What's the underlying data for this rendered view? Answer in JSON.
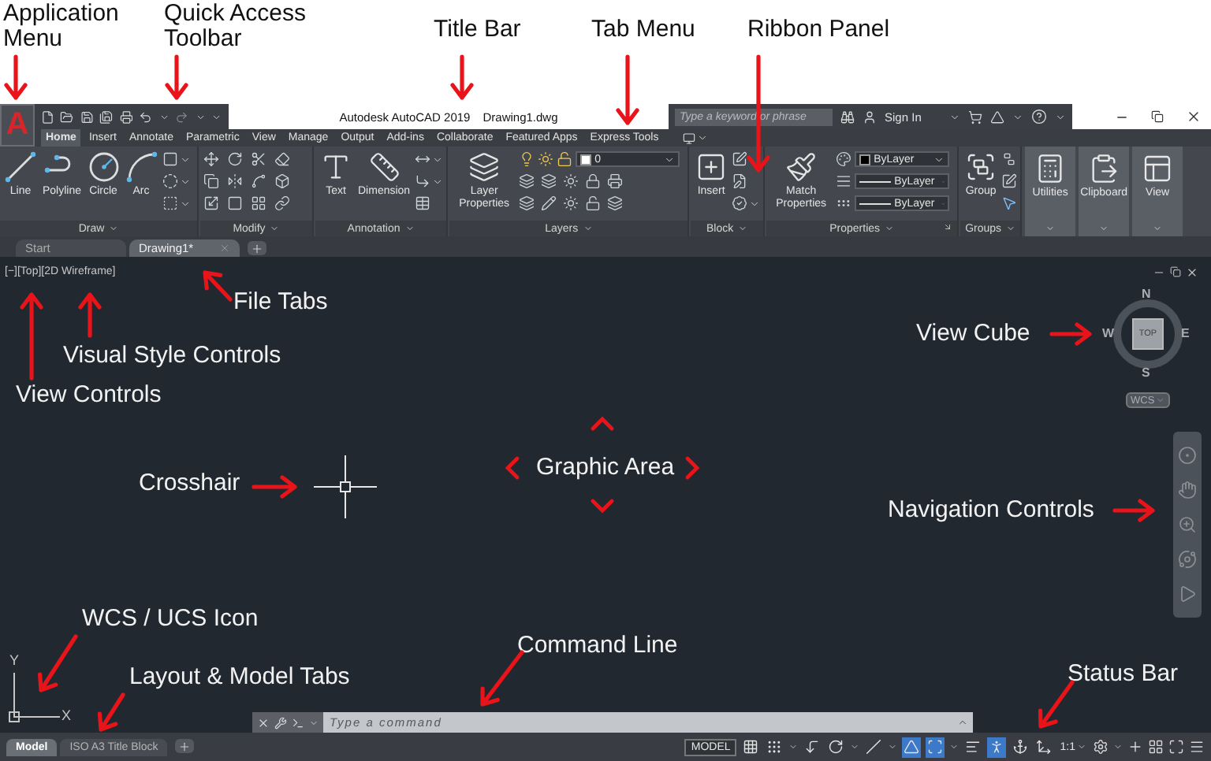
{
  "annotations": [
    "Application Menu",
    "Quick Access Toolbar",
    "Title Bar",
    "Tab Menu",
    "Ribbon Panel",
    "File Tabs",
    "Visual Style Controls",
    "View Controls",
    "View Cube",
    "Crosshair",
    "Graphic Area",
    "Navigation Controls",
    "WCS / UCS Icon",
    "Layout & Model Tabs",
    "Command Line",
    "Status Bar"
  ],
  "app_menu": {
    "logo": "A"
  },
  "title_bar": {
    "app": "Autodesk AutoCAD 2019",
    "file": "Drawing1.dwg",
    "search": {
      "placeholder": "Type a keyword or phrase"
    },
    "sign_in": "Sign In"
  },
  "menu_tabs": [
    {
      "label": "Home",
      "selected": true
    },
    {
      "label": "Insert",
      "selected": false
    },
    {
      "label": "Annotate",
      "selected": false
    },
    {
      "label": "Parametric",
      "selected": false
    },
    {
      "label": "View",
      "selected": false
    },
    {
      "label": "Manage",
      "selected": false
    },
    {
      "label": "Output",
      "selected": false
    },
    {
      "label": "Add-ins",
      "selected": false
    },
    {
      "label": "Collaborate",
      "selected": false
    },
    {
      "label": "Featured Apps",
      "selected": false
    },
    {
      "label": "Express Tools",
      "selected": false
    }
  ],
  "ribbon_panels": [
    {
      "kind": "full",
      "title": "Draw",
      "tools": [
        "Line",
        "Polyline",
        "Circle",
        "Arc"
      ]
    },
    {
      "kind": "full",
      "title": "Modify"
    },
    {
      "kind": "full",
      "title": "Annotation",
      "tools": [
        "Text",
        "Dimension"
      ]
    },
    {
      "kind": "full",
      "title": "Layers",
      "tools": [
        "Layer Properties"
      ],
      "layer": "0"
    },
    {
      "kind": "full",
      "title": "Block",
      "tools": [
        "Insert"
      ]
    },
    {
      "kind": "full",
      "title": "Properties",
      "tools": [
        "Match Properties"
      ],
      "dropdowns": [
        "ByLayer",
        "ByLayer",
        "ByLayer"
      ]
    },
    {
      "kind": "full",
      "title": "Groups",
      "tools": [
        "Group"
      ]
    },
    {
      "kind": "collapsed",
      "label": "Utilities"
    },
    {
      "kind": "collapsed",
      "label": "Clipboard"
    },
    {
      "kind": "collapsed",
      "label": "View"
    }
  ],
  "file_tabs": [
    {
      "label": "Start",
      "selected": false
    },
    {
      "label": "Drawing1*",
      "selected": true
    }
  ],
  "viewport": {
    "controls": [
      "[−]",
      "[Top]",
      "[2D Wireframe]"
    ],
    "view_cube": {
      "face": "TOP",
      "compass": [
        "N",
        "E",
        "S",
        "W"
      ],
      "ucs_menu": "WCS"
    },
    "ucs_axes": [
      "X",
      "Y"
    ]
  },
  "command_line": {
    "placeholder": "Type a command"
  },
  "layout_tabs": [
    {
      "label": "Model",
      "selected": true
    },
    {
      "label": "ISO A3 Title Block",
      "selected": false
    }
  ],
  "status_bar": {
    "mode": "MODEL",
    "scale": "1:1",
    "toggles": [
      {
        "on": false
      },
      {
        "on": false
      },
      {
        "on": false
      },
      {
        "on": false
      },
      {
        "on": false
      },
      {
        "on": true
      },
      {
        "on": true
      },
      {
        "on": false
      },
      {
        "on": true
      },
      {
        "on": false
      },
      {
        "on": false
      }
    ]
  }
}
